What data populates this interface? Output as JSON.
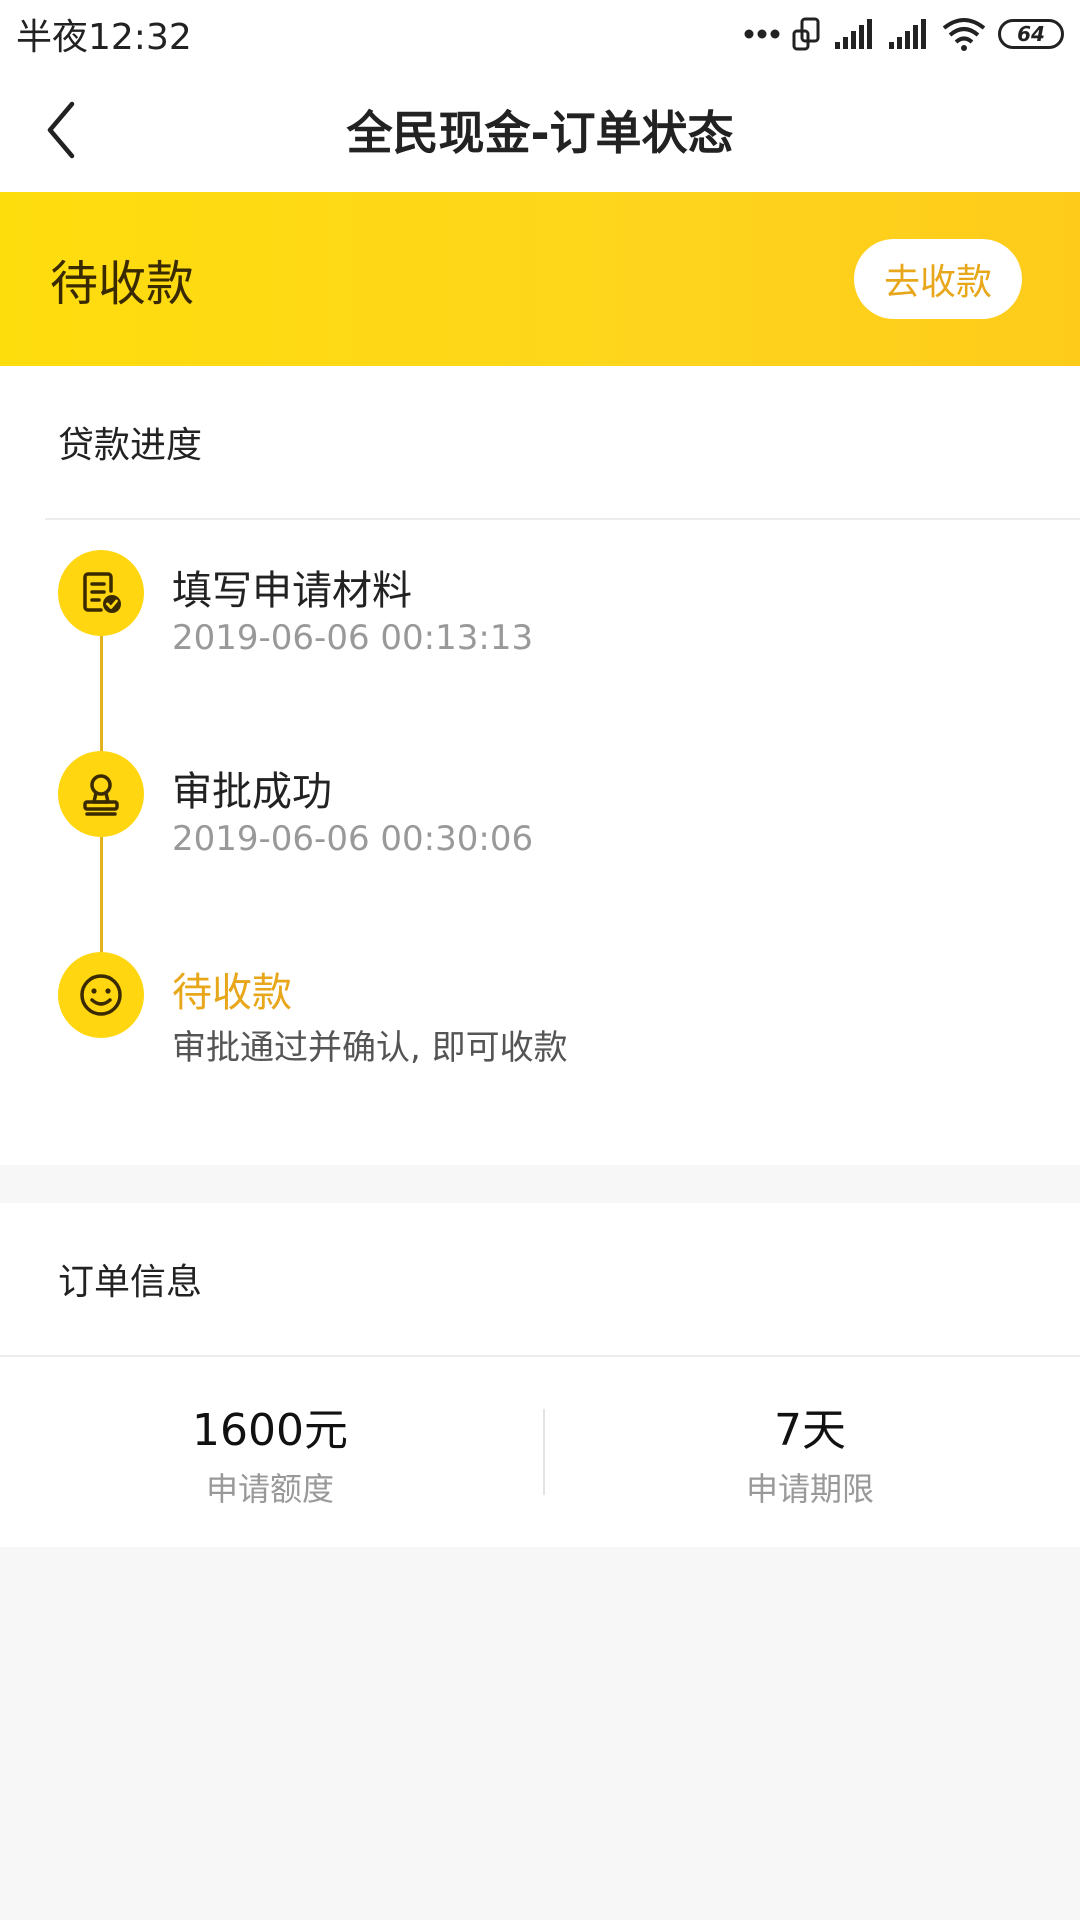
{
  "status_bar": {
    "time": "半夜12:32",
    "battery": "64"
  },
  "nav": {
    "title": "全民现金-订单状态"
  },
  "banner": {
    "status": "待收款",
    "button_label": "去收款"
  },
  "progress": {
    "header": "贷款进度",
    "steps": [
      {
        "title": "填写申请材料",
        "subtitle": "2019-06-06 00:13:13",
        "icon": "form-check-icon"
      },
      {
        "title": "审批成功",
        "subtitle": "2019-06-06 00:30:06",
        "icon": "stamp-icon"
      },
      {
        "title": "待收款",
        "subtitle": "审批通过并确认, 即可收款",
        "icon": "smile-icon"
      }
    ]
  },
  "order": {
    "header": "订单信息",
    "amount_value": "1600元",
    "amount_label": "申请额度",
    "term_value": "7天",
    "term_label": "申请期限"
  },
  "colors": {
    "accent": "#ffd60f",
    "accent_text": "#e8a71a"
  }
}
